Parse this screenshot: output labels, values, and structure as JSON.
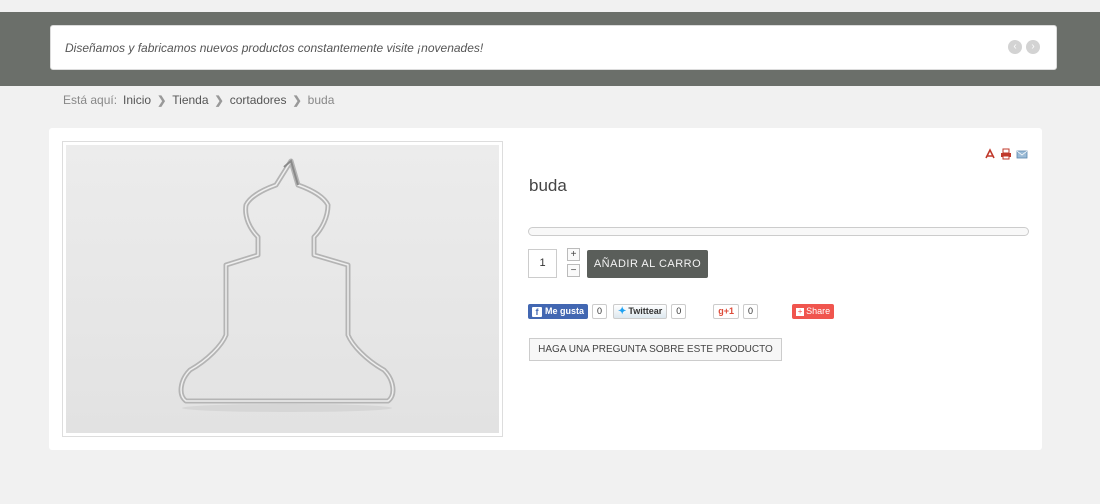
{
  "ticker": {
    "text": "Diseñamos y fabricamos nuevos productos constantemente visite ¡novenades!",
    "prev_icon": "‹",
    "next_icon": "›"
  },
  "breadcrumb": {
    "prefix": "Está aquí:",
    "items": [
      "Inicio",
      "Tienda",
      "cortadores",
      "buda"
    ],
    "separator": "❯"
  },
  "product": {
    "title": "buda",
    "quantity": "1",
    "plus": "+",
    "minus": "−",
    "add_to_cart": "AÑADIR AL CARRO",
    "ask_question": "HAGA UNA PREGUNTA SOBRE ESTE PRODUCTO",
    "tools": [
      "pdf-icon",
      "print-icon",
      "email-icon"
    ]
  },
  "social": {
    "facebook_label": "Me gusta",
    "facebook_count": "0",
    "twitter_label": "Twittear",
    "twitter_count": "0",
    "gplus_label": "+1",
    "gplus_count": "0",
    "share_label": "Share"
  },
  "colors": {
    "header_band": "#6b6f6a",
    "cart_button": "#5a5e5a",
    "facebook": "#4267b2",
    "share": "#f0554e"
  }
}
